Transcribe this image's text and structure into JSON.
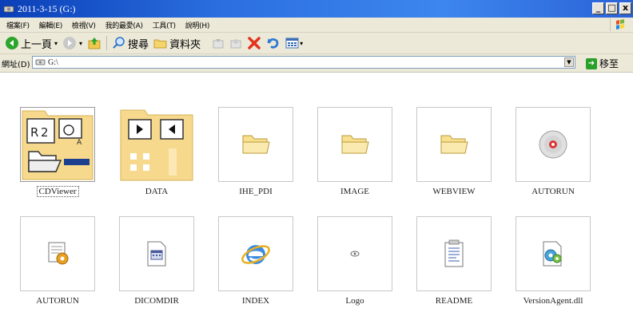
{
  "window": {
    "title": "2011-3-15 (G:)"
  },
  "menu": [
    "檔案(F)",
    "編輯(E)",
    "檢視(V)",
    "我的最愛(A)",
    "工具(T)",
    "說明(H)"
  ],
  "toolbar": {
    "back": "上一頁",
    "search": "搜尋",
    "folders": "資料夾"
  },
  "address": {
    "label": "網址(D)",
    "value": "G:\\",
    "go": "移至"
  },
  "files": [
    {
      "name": "CDViewer",
      "icon": "cdviewer-folder-icon",
      "selected": true
    },
    {
      "name": "DATA",
      "icon": "data-folder-icon"
    },
    {
      "name": "IHE_PDI",
      "icon": "folder-icon"
    },
    {
      "name": "IMAGE",
      "icon": "folder-icon"
    },
    {
      "name": "WEBVIEW",
      "icon": "folder-icon"
    },
    {
      "name": "AUTORUN",
      "icon": "cd-icon"
    },
    {
      "name": "AUTORUN",
      "icon": "setup-info-icon"
    },
    {
      "name": "DICOMDIR",
      "icon": "file-icon"
    },
    {
      "name": "INDEX",
      "icon": "ie-icon"
    },
    {
      "name": "Logo",
      "icon": "image-icon"
    },
    {
      "name": "README",
      "icon": "text-file-icon"
    },
    {
      "name": "VersionAgent.dll",
      "icon": "dll-icon"
    }
  ],
  "colors": {
    "titlebar": "#2b6fe0",
    "folder": "#f5d98a",
    "chrome": "#ece9d8"
  }
}
